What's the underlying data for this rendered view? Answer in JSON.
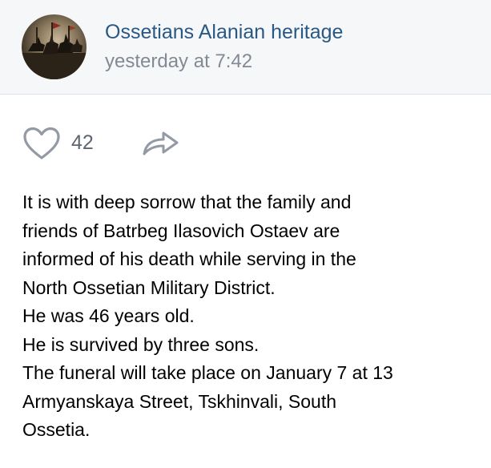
{
  "post": {
    "author": {
      "name": "Ossetians Alanian heritage",
      "avatar": "avatar-painting-horsemen"
    },
    "time": "yesterday at 7:42",
    "likes": {
      "icon": "heart-outline-icon",
      "count": "42"
    },
    "share": {
      "icon": "share-arrow-icon"
    },
    "text_lines": [
      "It is with deep sorrow that the family and",
      "friends of Batrbeg Ilasovich Ostaev are",
      "informed of his death while serving in the",
      "North Ossetian Military District.",
      "He was 46 years old.",
      "He is survived by three sons.",
      "The funeral will take place on January 7 at 13",
      "Armyanskaya Street, Tskhinvali, South",
      "Ossetia."
    ]
  },
  "colors": {
    "header_bg": "#f6f7f9",
    "link": "#2a5885",
    "muted": "#828a94",
    "icon": "#939aa3"
  }
}
